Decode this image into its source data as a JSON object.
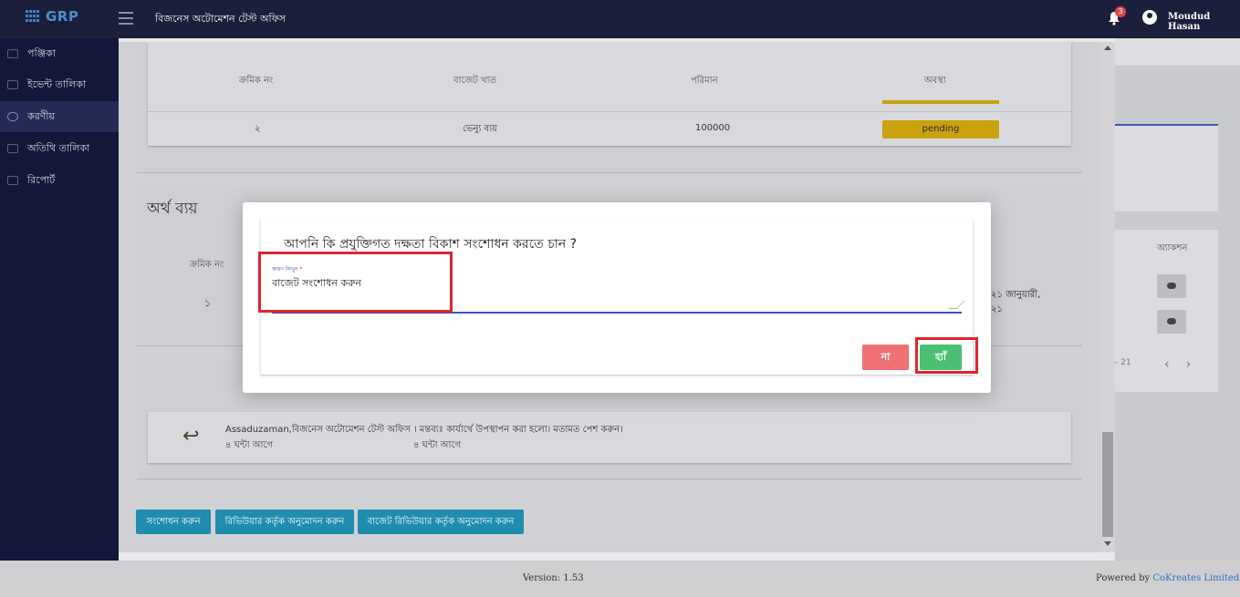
{
  "header": {
    "logo": "GRP",
    "app_title": "বিজনেস অটোমেশন টেস্ট অফিস",
    "notification_count": "3",
    "user_name": "Moudud Hasan"
  },
  "sidebar": {
    "items": [
      {
        "label": "পঞ্জিকা",
        "icon": "calendar-icon"
      },
      {
        "label": "ইভেন্ট তালিকা",
        "icon": "list-icon"
      },
      {
        "label": "করণীয়",
        "icon": "check-circle-icon",
        "active": true
      },
      {
        "label": "অতিথি তালিকা",
        "icon": "list-icon"
      },
      {
        "label": "রিপোর্ট",
        "icon": "print-icon"
      }
    ]
  },
  "budget_table": {
    "headers": [
      "ক্রমিক নং",
      "বাজেট খাত",
      "পরিমান",
      "অবস্থা"
    ],
    "rows": [
      {
        "serial": "২",
        "head": "ভেন্যু ব্যয়",
        "amount": "100000",
        "status": "pending"
      }
    ]
  },
  "expense_section": {
    "title": "অর্থ ব্যয়",
    "serial_header": "ক্রমিক নং",
    "row_serial": "১",
    "action_header": "অ্যাকশন",
    "date_line1": "২১ জানুয়ারী,",
    "date_line2": "২১",
    "pager_text": "- 21"
  },
  "note": {
    "text": "Assaduzaman,বিজনেস অটোমেশন টেস্ট অফিস । মন্তব্যঃ কার্যার্থে উপস্থাপন করা হলো। মতামত পেশ করুন।",
    "time_left": "৪ ঘন্টা আগে",
    "time_right": "৪ ঘন্টা আগে"
  },
  "actions": {
    "edit": "সংশোধন করুন",
    "reviewer_approve": "রিভিউয়ার কর্তৃক অনুমোদন করুন",
    "budget_reviewer_approve": "বাজেট রিভিউয়ার কর্তৃক অনুমোদন করুন"
  },
  "dialog": {
    "question": "আপনি কি প্রযুক্তিগত দক্ষতা বিকাশ সংশোধন করতে চান ?",
    "field_label": "কারণ লিখুন",
    "field_required": "*",
    "field_value": "বাজেট সংশোধন করুন",
    "no_label": "না",
    "yes_label": "হ্যাঁ"
  },
  "footer": {
    "version": "Version: 1.53",
    "powered_prefix": "Powered by",
    "powered_link": "CoKreates Limited"
  },
  "colors": {
    "topbar": "#1b1f3b",
    "sidebar": "#13173a",
    "accent": "#3f51b5",
    "status_pending": "#c9a20d",
    "no_button": "#ef7073",
    "yes_button": "#4bbf73",
    "action_button": "#1f8cb0",
    "highlight": "#e0252e"
  }
}
